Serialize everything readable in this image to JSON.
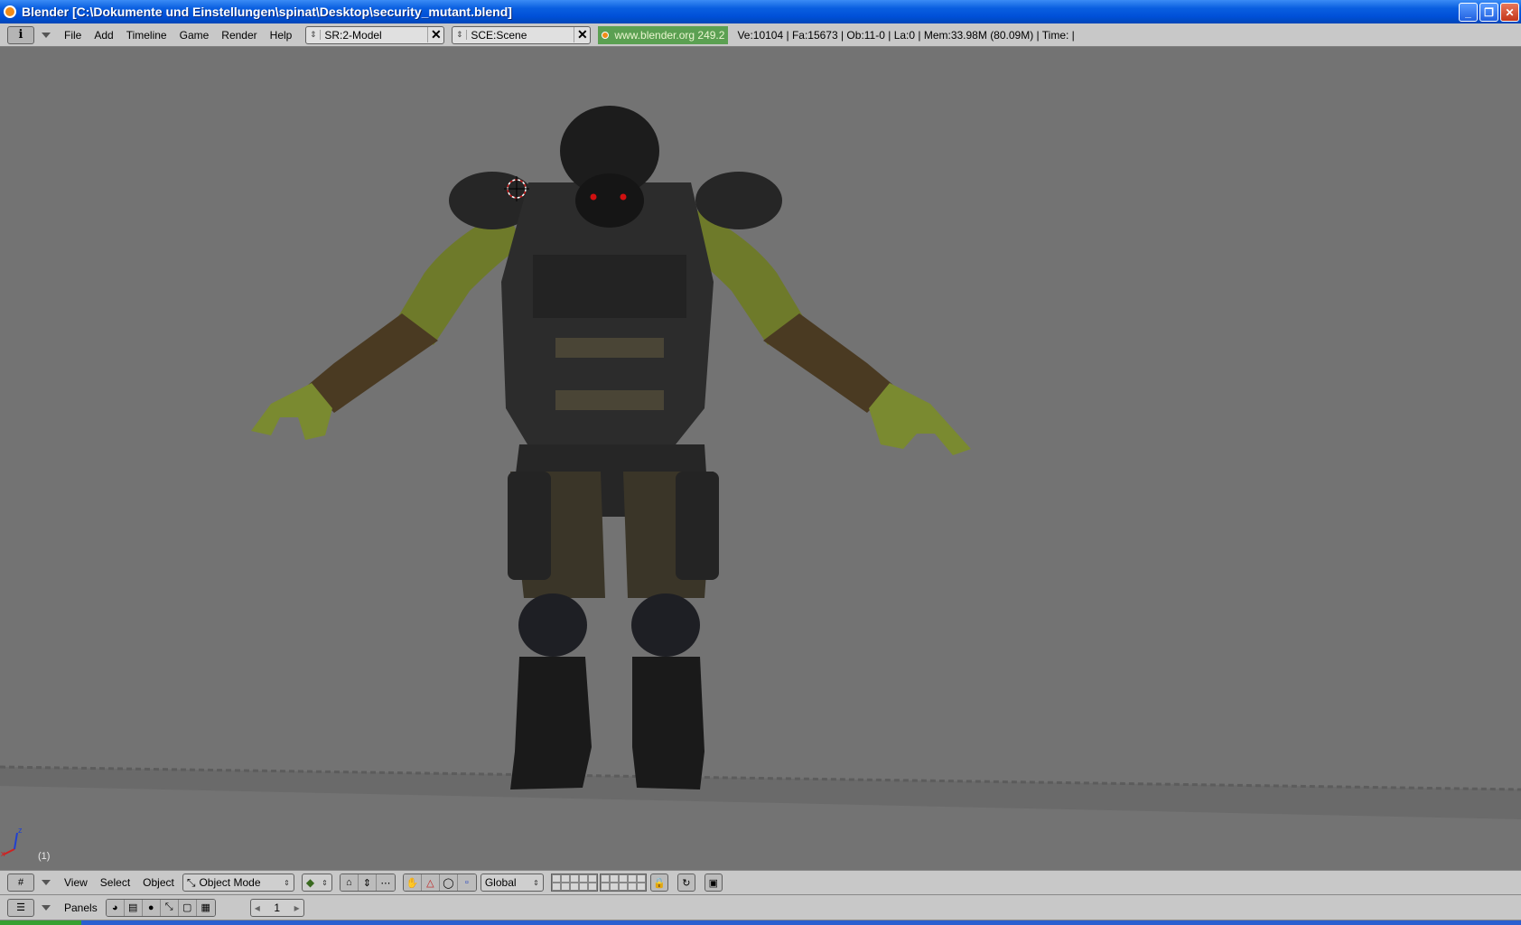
{
  "window": {
    "title": "Blender [C:\\Dokumente und Einstellungen\\spinat\\Desktop\\security_mutant.blend]",
    "buttons": [
      "minimize-icon",
      "restore-icon",
      "close-icon"
    ]
  },
  "info_header": {
    "editor_icon": "i",
    "menus": [
      "File",
      "Add",
      "Timeline",
      "Game",
      "Render",
      "Help"
    ],
    "screen": "SR:2-Model",
    "scene": "SCE:Scene",
    "url": "www.blender.org 249.2",
    "stats": "Ve:10104 | Fa:15673 | Ob:11-0 | La:0  | Mem:33.98M (80.09M)  | Time: |"
  },
  "viewport": {
    "frame_label": "(1)",
    "axis_labels": {
      "x": "x",
      "z": "z"
    },
    "background": "#737373"
  },
  "view_header": {
    "menus": [
      "View",
      "Select",
      "Object"
    ],
    "mode": "Object Mode",
    "orientation": "Global"
  },
  "buttons_header": {
    "panels_label": "Panels",
    "frame": "1"
  },
  "colors": {
    "title_blue": "#0050d8",
    "header_grey": "#c8c8c8",
    "viewport_grey": "#737373",
    "url_green": "#5ba052",
    "armor_dark": "#2a2a2a",
    "skin_green": "#6e7a2a"
  }
}
